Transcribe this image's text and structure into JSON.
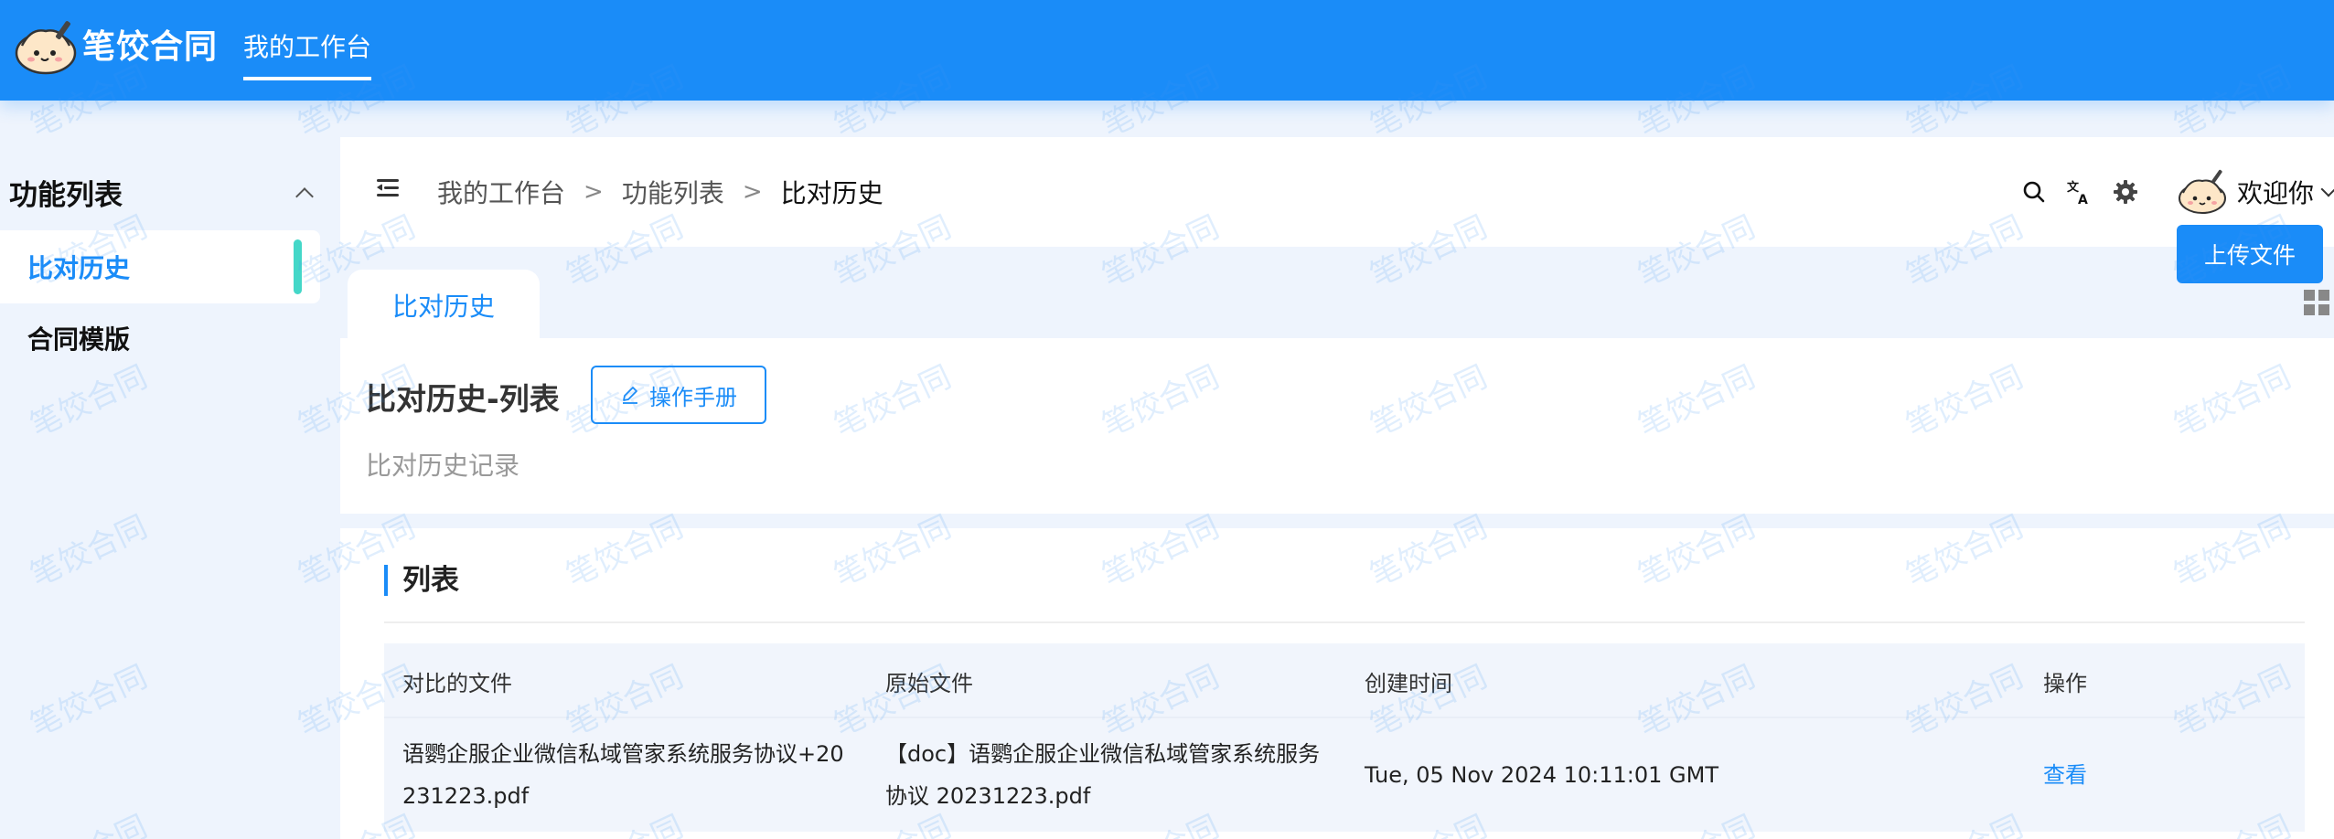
{
  "app": {
    "brand": "笔饺合同",
    "top_nav": [
      "我的工作台"
    ]
  },
  "sidebar": {
    "section_title": "功能列表",
    "items": [
      {
        "label": "比对历史",
        "active": true
      },
      {
        "label": "合同模版",
        "active": false
      }
    ]
  },
  "header": {
    "breadcrumb": [
      "我的工作台",
      "功能列表",
      "比对历史"
    ],
    "breadcrumb_separator": ">",
    "tools": [
      "search-icon",
      "translate-icon",
      "gear-icon"
    ],
    "welcome": "欢迎你"
  },
  "tabs": [
    "比对历史"
  ],
  "page": {
    "title": "比对历史-列表",
    "manual_button": "操作手册",
    "subtitle": "比对历史记录",
    "upload_button": "上传文件"
  },
  "list": {
    "title": "列表",
    "columns": [
      "对比的文件",
      "原始文件",
      "创建时间",
      "操作"
    ],
    "rows": [
      {
        "compared_file_line1": "语鹦企服企业微信私域管家系统服务协议+20",
        "compared_file_line2": "231223.pdf",
        "original_file_line1": "【doc】语鹦企服企业微信私域管家系统服务",
        "original_file_line2": "协议 20231223.pdf",
        "created_at": "Tue, 05 Nov 2024 10:11:01 GMT",
        "action": "查看"
      }
    ]
  },
  "watermark_text": "笔饺合同",
  "colors": {
    "primary": "#1a8cf8",
    "accent_bar": "#44d7c8",
    "background": "#eef4fd"
  }
}
